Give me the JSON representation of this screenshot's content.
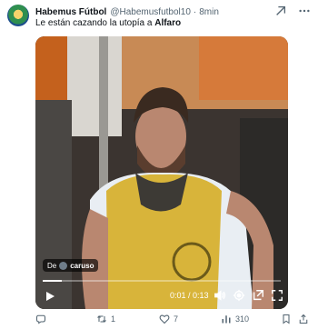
{
  "tweet": {
    "display_name": "Habemus Fútbol",
    "handle": "@Habemusfutbol10",
    "separator": "·",
    "time": "8min",
    "text_before": "Le están cazando la utopía a ",
    "mention": "Alfaro"
  },
  "video": {
    "credit_prefix": "De",
    "credit_name": "caruso",
    "timecode": "0:01 / 0:13",
    "progress": 0.08
  },
  "actions": {
    "reply_count": "",
    "retweet_count": "1",
    "like_count": "7",
    "views_count": "310"
  },
  "icons": {
    "avatar": "team-logo",
    "top": [
      "grok-icon",
      "more-icon"
    ],
    "controls": [
      "play-icon",
      "volume-icon",
      "settings-icon",
      "popout-icon",
      "fullscreen-icon"
    ],
    "actions": [
      "reply-icon",
      "retweet-icon",
      "like-icon",
      "views-icon",
      "bookmark-icon",
      "share-icon"
    ]
  },
  "colors": {
    "text": "#0f1419",
    "muted": "#536471",
    "jersey": "#d8b43a"
  }
}
